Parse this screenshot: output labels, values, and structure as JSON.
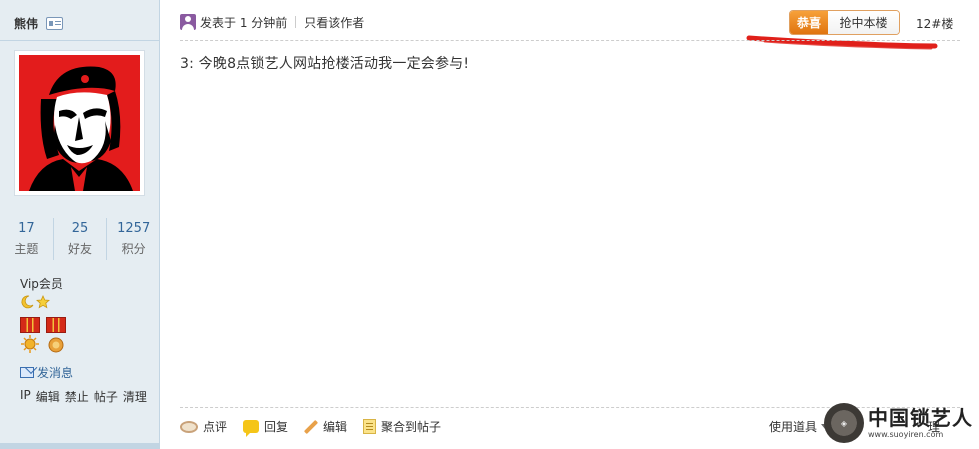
{
  "user": {
    "name": "熊伟",
    "stats": [
      {
        "value": "17",
        "label": "主题"
      },
      {
        "value": "25",
        "label": "好友"
      },
      {
        "value": "1257",
        "label": "积分"
      }
    ],
    "group": "Vip会员",
    "send_message": "发消息",
    "admin_links": [
      "IP",
      "编辑",
      "禁止",
      "帖子",
      "清理"
    ]
  },
  "post": {
    "posted_time": "发表于 1 分钟前",
    "only_author": "只看该作者",
    "badge_congrats": "恭喜",
    "badge_grab": "抢中本楼",
    "floor": "12#楼",
    "content": "3: 今晚8点锁艺人网站抢楼活动我一定会参与!"
  },
  "actions": [
    {
      "label": "点评"
    },
    {
      "label": "回复"
    },
    {
      "label": "编辑"
    },
    {
      "label": "聚合到帖子"
    }
  ],
  "tools": {
    "use_items": "使用道具",
    "right_partial": "理"
  },
  "watermark": {
    "title": "中国锁艺人",
    "url": "www.suoyiren.com"
  },
  "colors": {
    "sidebar_bg": "#e5edf2",
    "accent_blue": "#336699",
    "badge_orange": "#f08a1a",
    "highlight_red": "#e0201a"
  }
}
